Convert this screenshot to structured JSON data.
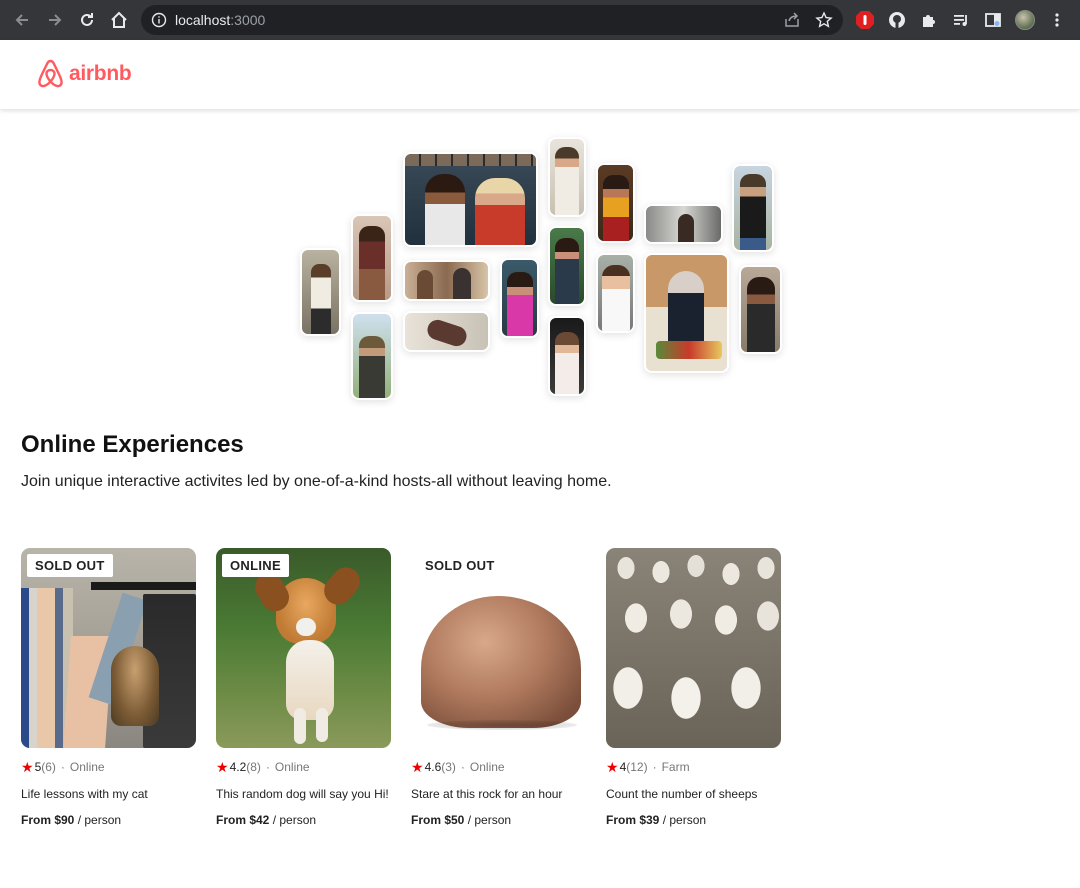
{
  "browser": {
    "url_host": "localhost",
    "url_port": ":3000"
  },
  "brand": {
    "logo_text": "airbnb",
    "accent": "#ff5a5f"
  },
  "main": {
    "title": "Online Experiences",
    "subtitle": "Join unique interactive activites led by one-of-a-kind hosts-all without leaving home."
  },
  "cards": [
    {
      "badge": "SOLD OUT",
      "rating": "5",
      "reviews": "(6)",
      "location": "Online",
      "title": "Life lessons with my cat",
      "price": "From $90",
      "per": " / person"
    },
    {
      "badge": "ONLINE",
      "rating": "4.2",
      "reviews": "(8)",
      "location": "Online",
      "title": "This random dog will say you Hi!",
      "price": "From $42",
      "per": " / person"
    },
    {
      "badge": "SOLD OUT",
      "rating": "4.6",
      "reviews": "(3)",
      "location": "Online",
      "title": "Stare at this rock for an hour",
      "price": "From $50",
      "per": " / person"
    },
    {
      "badge": "",
      "rating": "4",
      "reviews": "(12)",
      "location": "Farm",
      "title": "Count the number of sheeps",
      "price": "From $39",
      "per": " / person"
    }
  ],
  "symbols": {
    "star": "★",
    "dot": "·"
  }
}
